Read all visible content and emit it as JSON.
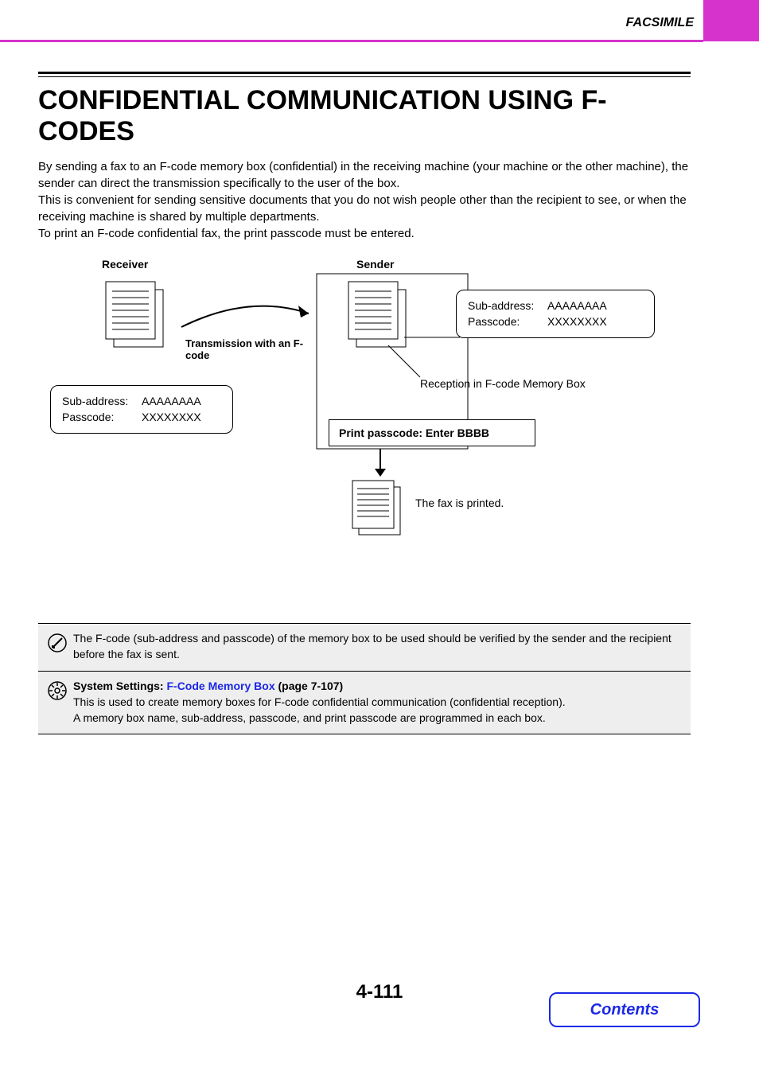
{
  "header": {
    "section": "FACSIMILE"
  },
  "title": "CONFIDENTIAL COMMUNICATION USING F-CODES",
  "paragraphs": {
    "p1": "By sending a fax to an F-code memory box (confidential) in the receiving machine (your machine or the other machine), the sender can direct the transmission specifically to the user of the box.",
    "p2": "This is convenient for sending sensitive documents that you do not wish people other than the recipient to see, or when the receiving machine is shared by multiple departments.",
    "p3": "To print an F-code confidential fax, the print passcode must be entered."
  },
  "diagram": {
    "receiver_label": "Receiver",
    "sender_label": "Sender",
    "transmission_label": "Transmission with an F-code",
    "subaddress_key": "Sub-address:",
    "passcode_key": "Passcode:",
    "subaddress_val": "AAAAAAAA",
    "passcode_val": "XXXXXXXX",
    "reception_text": "Reception in F-code Memory Box",
    "print_passcode": "Print passcode: Enter BBBB",
    "printed_text": "The fax is printed."
  },
  "notes": {
    "note1": "The F-code (sub-address and passcode) of the memory box to be used should be verified by the sender and the recipient before the fax is sent.",
    "note2_prefix": "System Settings: ",
    "note2_link": "F-Code Memory Box",
    "note2_suffix": " (page 7-107)",
    "note2_line2": "This is used to create memory boxes for F-code confidential communication (confidential reception).",
    "note2_line3": "A memory box name, sub-address, passcode, and print passcode are programmed in each box."
  },
  "footer": {
    "page": "4-111",
    "contents": "Contents"
  }
}
